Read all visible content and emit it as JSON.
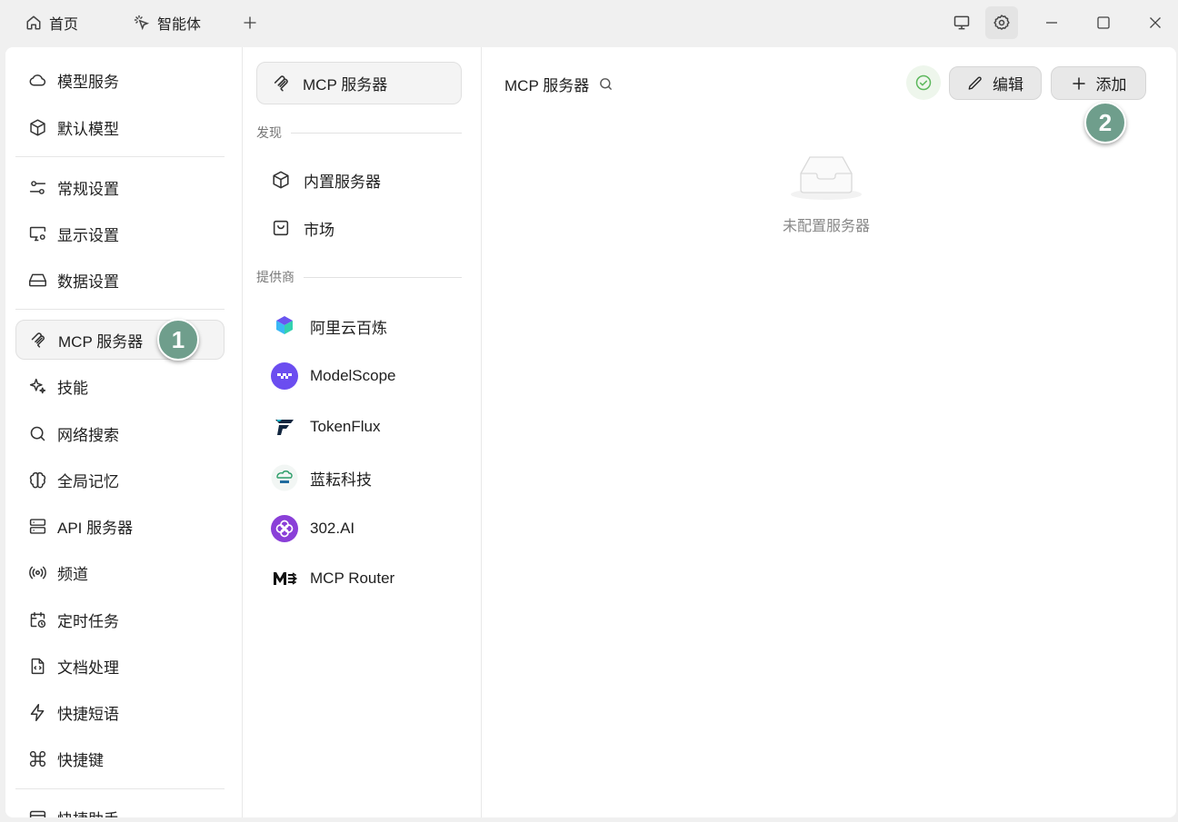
{
  "titlebar": {
    "tabs": [
      {
        "label": "首页",
        "icon": "home-icon"
      },
      {
        "label": "智能体",
        "icon": "sparkle-cursor-icon"
      }
    ],
    "new_tab_icon": "plus-icon",
    "controls": [
      "monitor-icon",
      "settings-gear-icon",
      "minimize-icon",
      "maximize-icon",
      "close-icon"
    ]
  },
  "sidebar": {
    "items": [
      {
        "label": "模型服务",
        "icon": "cloud-icon"
      },
      {
        "label": "默认模型",
        "icon": "cube-icon"
      },
      {
        "label": "常规设置",
        "icon": "sliders-icon"
      },
      {
        "label": "显示设置",
        "icon": "monitor-settings-icon"
      },
      {
        "label": "数据设置",
        "icon": "hard-drive-icon"
      },
      {
        "label": "MCP 服务器",
        "icon": "mcp-icon",
        "active": true
      },
      {
        "label": "技能",
        "icon": "sparkles-icon"
      },
      {
        "label": "网络搜索",
        "icon": "search-icon"
      },
      {
        "label": "全局记忆",
        "icon": "brain-icon"
      },
      {
        "label": "API 服务器",
        "icon": "server-icon"
      },
      {
        "label": "频道",
        "icon": "broadcast-icon"
      },
      {
        "label": "定时任务",
        "icon": "calendar-clock-icon"
      },
      {
        "label": "文档处理",
        "icon": "file-code-icon"
      },
      {
        "label": "快捷短语",
        "icon": "zap-icon"
      },
      {
        "label": "快捷键",
        "icon": "command-icon"
      },
      {
        "label": "快捷助手",
        "icon": "app-window-icon"
      }
    ],
    "step_badge": "1"
  },
  "mcp_nav": {
    "top_item": "MCP 服务器",
    "discover_label": "发现",
    "discover_items": [
      {
        "label": "内置服务器",
        "icon": "cube-icon"
      },
      {
        "label": "市场",
        "icon": "shopping-bag-icon"
      }
    ],
    "providers_label": "提供商",
    "providers": [
      {
        "label": "阿里云百炼",
        "icon": "bailian-logo"
      },
      {
        "label": "ModelScope",
        "icon": "modelscope-logo"
      },
      {
        "label": "TokenFlux",
        "icon": "tokenflux-logo"
      },
      {
        "label": "蓝耘科技",
        "icon": "lanyun-logo"
      },
      {
        "label": "302.AI",
        "icon": "302ai-logo"
      },
      {
        "label": "MCP Router",
        "icon": "mcp-router-logo"
      }
    ]
  },
  "content": {
    "title": "MCP 服务器",
    "edit_label": "编辑",
    "add_label": "添加",
    "step_badge": "2",
    "empty_text": "未配置服务器"
  },
  "colors": {
    "badge": "#6f9e8c",
    "status_ok": "#5cb85c",
    "background": "#f0f0f0"
  }
}
